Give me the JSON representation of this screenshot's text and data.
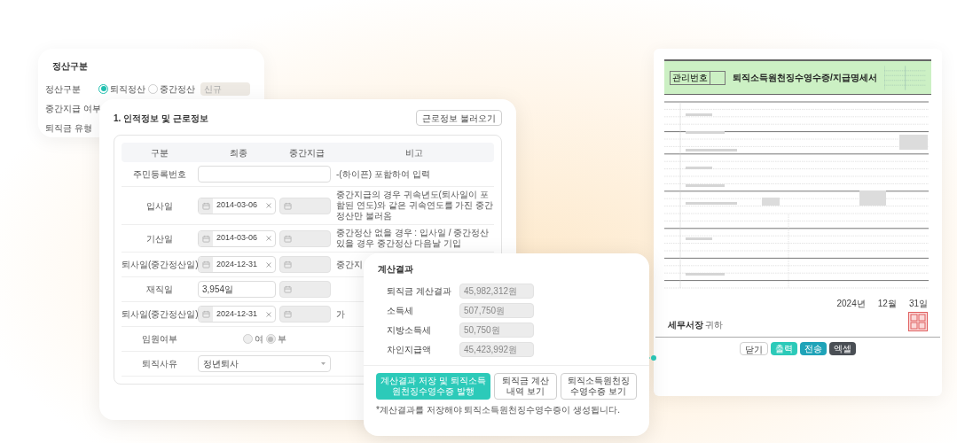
{
  "settlement_card": {
    "title": "정산구분",
    "rows": [
      {
        "label": "정산구분",
        "kind": "radio",
        "options": [
          {
            "label": "퇴직정산",
            "selected": true
          },
          {
            "label": "중간정산",
            "selected": false
          }
        ],
        "select": {
          "value": "신규",
          "disabled": true
        }
      },
      {
        "label": "중간지급 여부",
        "kind": "plain"
      },
      {
        "label": "퇴직금 유형",
        "kind": "plain"
      }
    ]
  },
  "info_card": {
    "title": "1. 인적정보 및 근로정보",
    "load_button": "근로정보 불러오기",
    "columns": [
      "구분",
      "최종",
      "중간지급",
      "비고"
    ],
    "rows": [
      {
        "label": "주민등록번호",
        "kind": "wide_input",
        "note": "-(하이픈) 포함하여 입력"
      },
      {
        "label": "입사일",
        "kind": "date",
        "value": "2014-03-06",
        "note": "중간지급의 경우 귀속년도(퇴사일이 포함된 연도)와 같은 귀속연도를 가진 중간정산만 불러옴"
      },
      {
        "label": "기산일",
        "kind": "date",
        "value": "2014-03-06",
        "note": "중간정산 없을 경우 : 입사일 / 중간정산 있을 경우 중간정산 다음날 기입"
      },
      {
        "label": "퇴사일(중간정산일)",
        "kind": "date",
        "value": "2024-12-31",
        "note": "중간지"
      },
      {
        "label": "재직일",
        "kind": "days",
        "value": "3,954일"
      },
      {
        "label": "퇴사일(중간정산일)",
        "kind": "date",
        "value": "2024-12-31",
        "note": "가"
      },
      {
        "label": "임원여부",
        "kind": "radio",
        "disabled": true,
        "options": [
          {
            "label": "여",
            "selected": false
          },
          {
            "label": "부",
            "selected": true
          }
        ]
      },
      {
        "label": "퇴직사유",
        "kind": "select",
        "value": "정년퇴사"
      }
    ]
  },
  "result_card": {
    "title": "계산결과",
    "items": [
      {
        "label": "퇴직금 계산결과",
        "value": "45,982,312원"
      },
      {
        "label": "소득세",
        "value": "507,750원"
      },
      {
        "label": "지방소득세",
        "value": "50,750원"
      },
      {
        "label": "차인지급액",
        "value": "45,423,992원"
      }
    ],
    "buttons": [
      {
        "label": "계산결과 저장 및 퇴직소득원천징수영수증 발행",
        "primary": true
      },
      {
        "label": "퇴직금 계산내역 보기",
        "primary": false
      },
      {
        "label": "퇴직소득원천징수영수증 보기",
        "primary": false
      }
    ],
    "footnote": "*계산결과를 저장해야 퇴직소득원천징수영수증이 생성됩니다."
  },
  "document": {
    "title": "퇴직소득원천징수영수증/지급명세서",
    "management_label": "관리번호",
    "date": [
      "2024년",
      "12월",
      "31일"
    ],
    "addressee": "세무서장",
    "addressee_suffix": "귀하",
    "buttons": [
      {
        "label": "닫기",
        "kind": "outline"
      },
      {
        "label": "출력",
        "kind": "teal"
      },
      {
        "label": "전송",
        "kind": "blue"
      },
      {
        "label": "엑셀",
        "kind": "dark"
      }
    ]
  }
}
